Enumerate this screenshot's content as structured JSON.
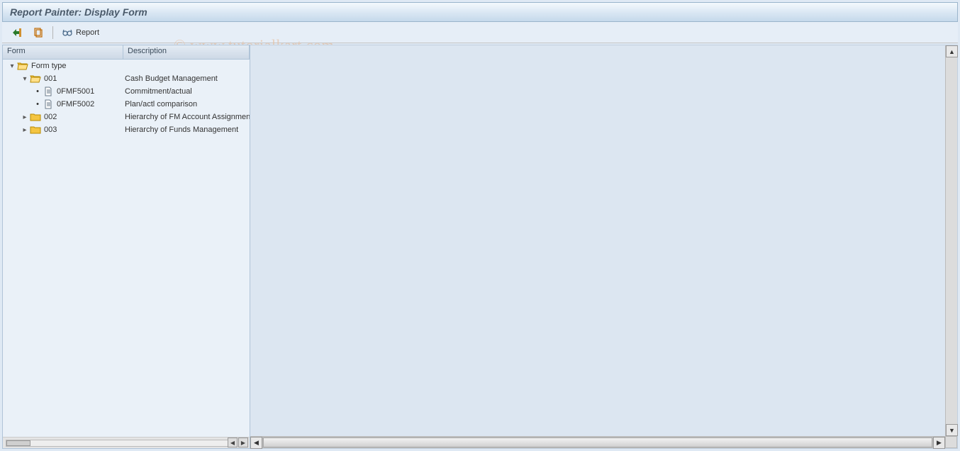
{
  "title": "Report Painter: Display Form",
  "toolbar": {
    "report_label": "Report"
  },
  "tree": {
    "headers": {
      "form": "Form",
      "description": "Description"
    },
    "root": {
      "label": "Form type",
      "description": ""
    },
    "nodes": [
      {
        "id": "001",
        "label": "001",
        "description": "Cash Budget Management",
        "expanded": true,
        "children": [
          {
            "id": "0FMF5001",
            "label": "0FMF5001",
            "description": "Commitment/actual"
          },
          {
            "id": "0FMF5002",
            "label": "0FMF5002",
            "description": "Plan/actl comparison"
          }
        ]
      },
      {
        "id": "002",
        "label": "002",
        "description": "Hierarchy of FM Account Assignments",
        "expanded": false
      },
      {
        "id": "003",
        "label": "003",
        "description": "Hierarchy of Funds Management",
        "expanded": false
      }
    ]
  },
  "watermark": "© www.tutorialkart.com"
}
